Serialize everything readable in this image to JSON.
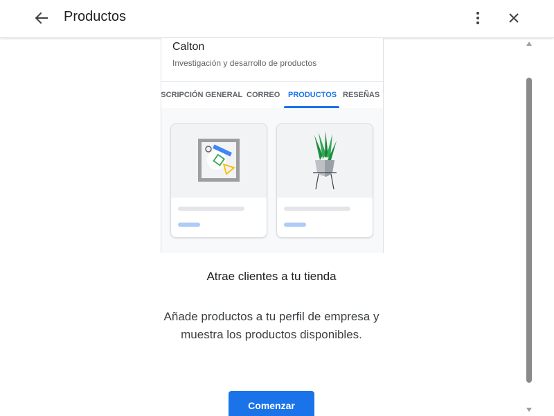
{
  "header": {
    "title": "Productos",
    "back_icon": "arrow-back-icon",
    "more_icon": "more-vert-icon",
    "close_icon": "close-icon"
  },
  "preview": {
    "business_name": "Calton",
    "business_category": "Investigación y desarrollo de productos",
    "tabs": [
      {
        "label": "DESCRIPCIÓN GENERAL",
        "active": false
      },
      {
        "label": "CORREO",
        "active": false
      },
      {
        "label": "PRODUCTOS",
        "active": true
      },
      {
        "label": "RESEÑAS",
        "active": false
      }
    ],
    "cards": [
      {
        "illustration": "shapes-frame-illustration"
      },
      {
        "illustration": "potted-plant-illustration"
      }
    ]
  },
  "main": {
    "headline": "Atrae clientes a tu tienda",
    "description": "Añade productos a tu perfil de empresa y muestra los productos disponibles.",
    "cta_label": "Comenzar"
  },
  "colors": {
    "accent": "#1a73e8",
    "placeholder_line": "#e3e5e8",
    "placeholder_accent": "#aecbfa"
  }
}
